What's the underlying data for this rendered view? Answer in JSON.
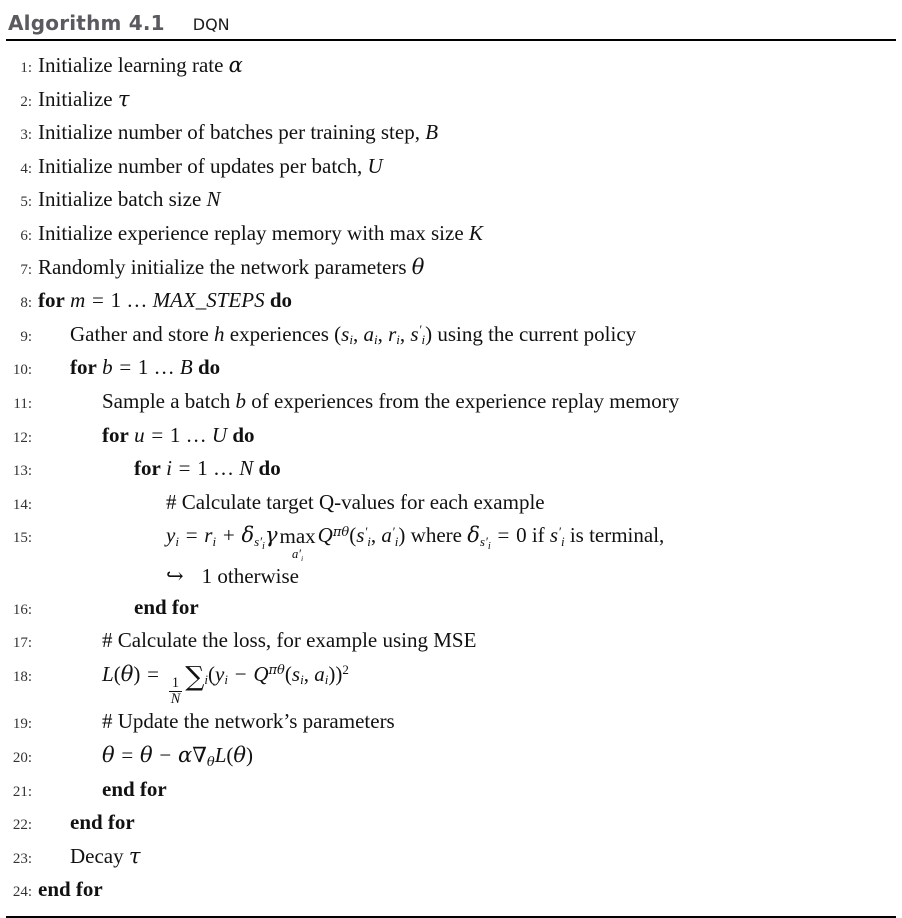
{
  "header": {
    "title": "Algorithm 4.1",
    "caption": "DQN"
  },
  "colors": {
    "title": "#5a5a60",
    "text": "#111111",
    "rule": "#000000"
  },
  "lines": [
    {
      "no": "1:",
      "indent": 0,
      "text": "Initialize learning rate α"
    },
    {
      "no": "2:",
      "indent": 0,
      "text": "Initialize τ"
    },
    {
      "no": "3:",
      "indent": 0,
      "text": "Initialize number of batches per training step, B"
    },
    {
      "no": "4:",
      "indent": 0,
      "text": "Initialize number of updates per batch, U"
    },
    {
      "no": "5:",
      "indent": 0,
      "text": "Initialize batch size N"
    },
    {
      "no": "6:",
      "indent": 0,
      "text": "Initialize experience replay memory with max size K"
    },
    {
      "no": "7:",
      "indent": 0,
      "text": "Randomly initialize the network parameters θ"
    },
    {
      "no": "8:",
      "indent": 0,
      "text": "for m = 1 … MAX_STEPS do"
    },
    {
      "no": "9:",
      "indent": 1,
      "text": "Gather and store h experiences (sᵢ, aᵢ, rᵢ, s′ᵢ) using the current policy"
    },
    {
      "no": "10:",
      "indent": 1,
      "text": "for b = 1 … B do"
    },
    {
      "no": "11:",
      "indent": 2,
      "text": "Sample a batch b of experiences from the experience replay memory"
    },
    {
      "no": "12:",
      "indent": 2,
      "text": "for u = 1 … U do"
    },
    {
      "no": "13:",
      "indent": 3,
      "text": "for i = 1 … N do"
    },
    {
      "no": "14:",
      "indent": 4,
      "text": "# Calculate target Q-values for each example"
    },
    {
      "no": "15:",
      "indent": 4,
      "text": "yᵢ = rᵢ + δₛ′ᵢ γ max_{a′ᵢ} Q^{πθ}(s′ᵢ, a′ᵢ) where δₛ′ᵢ = 0 if s′ᵢ is terminal,"
    },
    {
      "no": "",
      "indent": 4,
      "text": "↪  1 otherwise"
    },
    {
      "no": "16:",
      "indent": 3,
      "text": "end for"
    },
    {
      "no": "17:",
      "indent": 2,
      "text": "# Calculate the loss, for example using MSE"
    },
    {
      "no": "18:",
      "indent": 2,
      "text": "L(θ) = 1/N ∑ᵢ(yᵢ − Q^{πθ}(sᵢ, aᵢ))²"
    },
    {
      "no": "19:",
      "indent": 2,
      "text": "# Update the network’s parameters"
    },
    {
      "no": "20:",
      "indent": 2,
      "text": "θ = θ − α∇θL(θ)"
    },
    {
      "no": "21:",
      "indent": 2,
      "text": "end for"
    },
    {
      "no": "22:",
      "indent": 1,
      "text": "end for"
    },
    {
      "no": "23:",
      "indent": 1,
      "text": "Decay τ"
    },
    {
      "no": "24:",
      "indent": 0,
      "text": "end for"
    }
  ],
  "tokens": {
    "initialize": "Initialize",
    "learning_rate": "learning rate",
    "alpha": "α",
    "tau": "τ",
    "theta": "θ",
    "gamma": "γ",
    "delta": "δ",
    "pi": "π",
    "num_batches": "number of batches per training step,",
    "num_updates": "number of updates per batch,",
    "batch_size": "batch size",
    "replay_mem": "experience replay memory with max size",
    "randomly_init": "Randomly initialize the network parameters",
    "for": "for",
    "do": "do",
    "end_for": "end for",
    "equals": "=",
    "dots": "1 …",
    "max_steps": "MAX_STEPS",
    "B": "B",
    "U": "U",
    "N": "N",
    "K": "K",
    "m": "m",
    "b": "b",
    "u": "u",
    "i": "i",
    "h": "h",
    "gather": "Gather and store",
    "experiences": "experiences",
    "using_policy": "using the current policy",
    "sample": "Sample a batch",
    "of_exp_from": "of experiences from the experience replay memory",
    "comment_target": "# Calculate target Q-values for each example",
    "comment_loss": "# Calculate the loss, for example using MSE",
    "comment_update": "# Update the network’s parameters",
    "where": "where",
    "is_terminal": "is terminal,",
    "zero": "0",
    "if": "if",
    "one_otherwise": "1 otherwise",
    "hook_arrow": "↪",
    "decay": "Decay",
    "max": "max",
    "sum": "∑",
    "nabla": "∇",
    "minus": "−",
    "plus": "+",
    "one": "1",
    "two": "2",
    "L": "L",
    "Q": "Q",
    "y": "y",
    "r": "r",
    "s": "s",
    "a": "a",
    "prime": "′"
  }
}
